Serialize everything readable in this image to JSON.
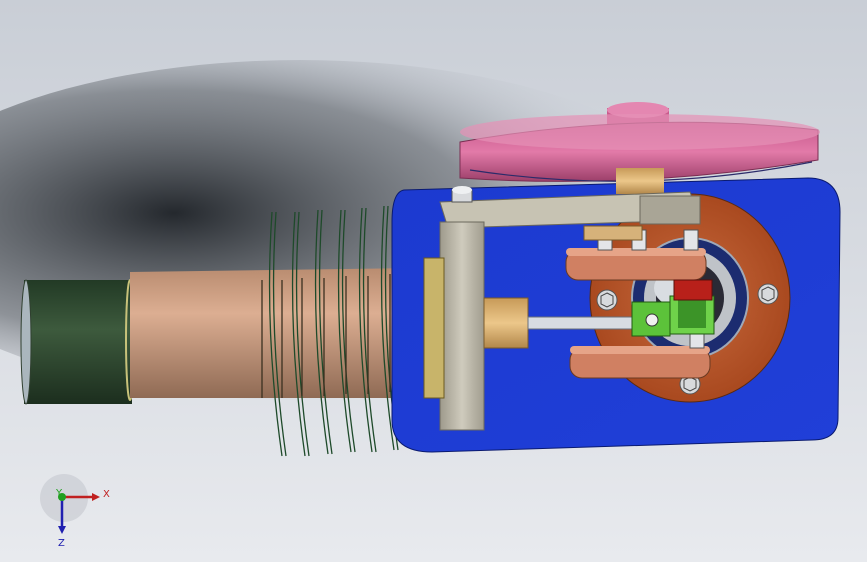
{
  "viewport": {
    "description_hidden": "",
    "background_top": "#c9ced6",
    "background_bottom": "#e6e8ec"
  },
  "colors": {
    "housing_blue": "#1f3fd6",
    "flywheel_pink": "#d9669a",
    "cylinder_tan": "#c89a7c",
    "cylinder_green": "#2f4a2f",
    "bearing_copper": "#b5552e",
    "link_copper": "#d07a5c",
    "bracket_gray": "#b8b4a6",
    "brass": "#d8b070",
    "green_block": "#5cc23a",
    "red_block": "#c0201a"
  },
  "triad": {
    "x_label": "X",
    "y_label": "Y",
    "z_label": "Z"
  }
}
